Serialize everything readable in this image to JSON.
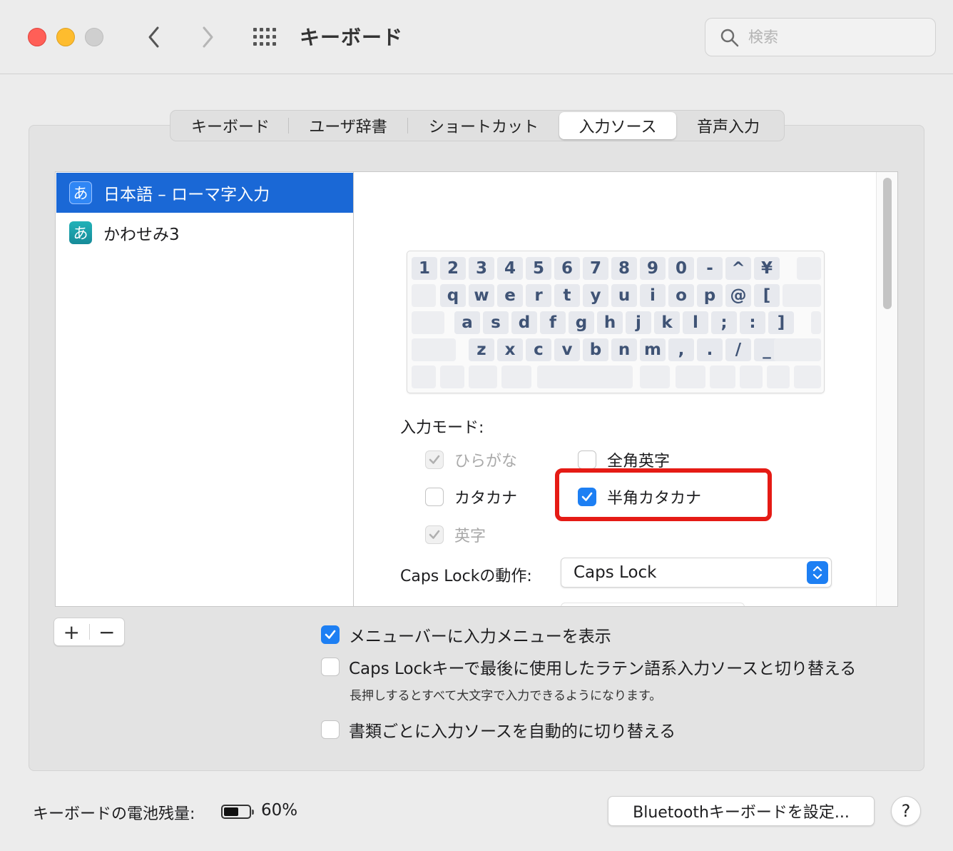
{
  "window": {
    "title": "キーボード"
  },
  "search": {
    "placeholder": "検索"
  },
  "tabs": [
    {
      "label": "キーボード",
      "active": false
    },
    {
      "label": "ユーザ辞書",
      "active": false
    },
    {
      "label": "ショートカット",
      "active": false
    },
    {
      "label": "入力ソース",
      "active": true
    },
    {
      "label": "音声入力",
      "active": false
    }
  ],
  "sources": [
    {
      "label": "日本語 – ローマ字入力",
      "icon_char": "あ",
      "icon": "hiragana-a-icon",
      "selected": true
    },
    {
      "label": "かわせみ3",
      "icon_char": "あ",
      "icon": "kawasemi-icon",
      "selected": false
    }
  ],
  "keyboard": {
    "rows": [
      [
        "1",
        "2",
        "3",
        "4",
        "5",
        "6",
        "7",
        "8",
        "9",
        "0",
        "-",
        "^",
        "¥"
      ],
      [
        "q",
        "w",
        "e",
        "r",
        "t",
        "y",
        "u",
        "i",
        "o",
        "p",
        "@",
        "["
      ],
      [
        "a",
        "s",
        "d",
        "f",
        "g",
        "h",
        "j",
        "k",
        "l",
        ";",
        ":",
        "]"
      ],
      [
        "z",
        "x",
        "c",
        "v",
        "b",
        "n",
        "m",
        ",",
        ".",
        "/",
        "_"
      ]
    ]
  },
  "input_modes": {
    "label": "入力モード:",
    "hiragana": {
      "label": "ひらがな",
      "checked": true,
      "disabled": true
    },
    "zenkaku_eiji": {
      "label": "全角英字",
      "checked": false,
      "disabled": false
    },
    "katakana": {
      "label": "カタカナ",
      "checked": false,
      "disabled": false
    },
    "hankaku_katakana": {
      "label": "半角カタカナ",
      "checked": true,
      "disabled": false
    },
    "eiji": {
      "label": "英字",
      "checked": true,
      "disabled": true
    }
  },
  "caps_lock": {
    "label": "Caps Lockの動作:",
    "value": "Caps Lock"
  },
  "list_controls": {
    "add": "+",
    "remove": "−"
  },
  "options": {
    "show_menu": {
      "label": "メニューバーに入力メニューを表示",
      "checked": true
    },
    "caps_switch": {
      "label": "Caps Lockキーで最後に使用したラテン語系入力ソースと切り替える",
      "checked": false
    },
    "caps_note": "長押しするとすべて大文字で入力できるようになります。",
    "auto_switch": {
      "label": "書類ごとに入力ソースを自動的に切り替える",
      "checked": false
    }
  },
  "footer": {
    "battery_label": "キーボードの電池残量:",
    "battery_value": "60%",
    "battery_level": 0.6,
    "bt_button": "Bluetoothキーボードを設定...",
    "help": "?"
  },
  "colors": {
    "accent": "#1d7ff3",
    "selection": "#1a68d6",
    "highlight_box": "#e51b15"
  }
}
